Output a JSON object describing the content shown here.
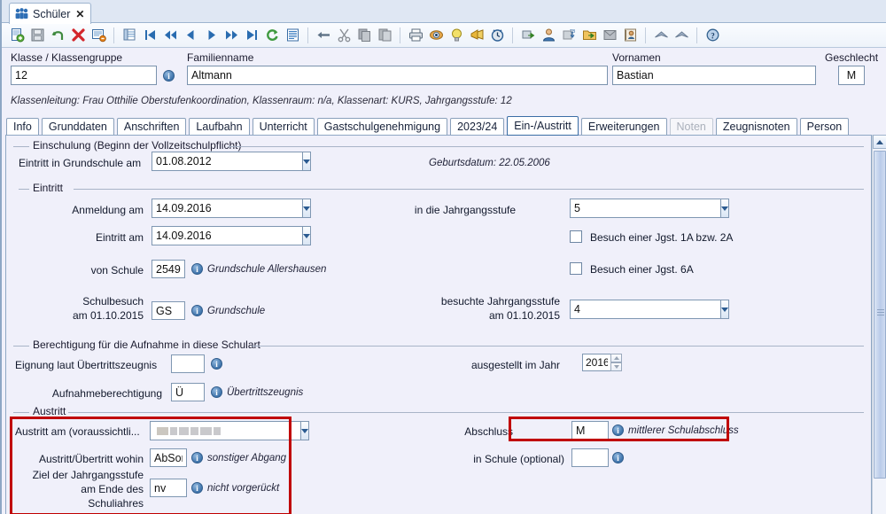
{
  "window": {
    "tab_label": "Schüler",
    "tab_close": "✕",
    "tab_icon": "people-icon"
  },
  "toolbar": {
    "buttons": [
      {
        "name": "new-record-icon",
        "title": "Neu"
      },
      {
        "name": "save-icon",
        "title": "Speichern"
      },
      {
        "name": "undo-icon",
        "title": "Rückgängig"
      },
      {
        "name": "delete-icon",
        "title": "Löschen"
      },
      {
        "name": "list-edit-icon",
        "title": "Bearbeiten"
      },
      {
        "name": "table-view-icon",
        "title": "Tabellenansicht"
      },
      {
        "name": "first-record-icon",
        "title": "Erster Datensatz"
      },
      {
        "name": "fast-back-icon",
        "title": "Zurück"
      },
      {
        "name": "prev-record-icon",
        "title": "Vorheriger"
      },
      {
        "name": "next-record-icon",
        "title": "Nächster"
      },
      {
        "name": "fast-forward-icon",
        "title": "Vorwärts"
      },
      {
        "name": "last-record-icon",
        "title": "Letzter Datensatz"
      },
      {
        "name": "refresh-icon",
        "title": "Aktualisieren"
      },
      {
        "name": "report-icon",
        "title": "Bericht"
      },
      {
        "name": "back-arrow-icon",
        "title": "Zurück"
      },
      {
        "name": "cut-icon",
        "title": "Ausschneiden"
      },
      {
        "name": "copy-icon",
        "title": "Kopieren"
      },
      {
        "name": "paste-icon",
        "title": "Einfügen"
      },
      {
        "name": "print-icon",
        "title": "Drucken"
      },
      {
        "name": "preview-icon",
        "title": "Vorschau"
      },
      {
        "name": "hint-icon",
        "title": "Hinweis"
      },
      {
        "name": "announce-icon",
        "title": "Meldung"
      },
      {
        "name": "clock-icon",
        "title": "Termin"
      },
      {
        "name": "package-export-icon",
        "title": "Export"
      },
      {
        "name": "user-icon",
        "title": "Benutzer"
      },
      {
        "name": "import-tb-icon",
        "title": "Import"
      },
      {
        "name": "folder-export-icon",
        "title": "Ordner Export"
      },
      {
        "name": "document-icon",
        "title": "Dokument"
      },
      {
        "name": "contact-card-icon",
        "title": "Kontakt"
      },
      {
        "name": "up-chevron-icon",
        "title": "Nach oben"
      },
      {
        "name": "up-chevron-2-icon",
        "title": "Ganz nach oben"
      },
      {
        "name": "help-icon",
        "title": "Hilfe"
      }
    ]
  },
  "header": {
    "klasse_label": "Klasse / Klassengruppe",
    "klasse_value": "12",
    "familienname_label": "Familienname",
    "familienname_value": "Altmann",
    "vornamen_label": "Vornamen",
    "vornamen_value": "Bastian",
    "geschlecht_label": "Geschlecht",
    "geschlecht_value": "M",
    "subline": "Klassenleitung: Frau Otthilie Oberstufenkoordination, Klassenraum: n/a, Klassenart: KURS, Jahrgangsstufe: 12"
  },
  "tabs": [
    {
      "label": "Info",
      "active": false,
      "disabled": false
    },
    {
      "label": "Grunddaten",
      "active": false,
      "disabled": false
    },
    {
      "label": "Anschriften",
      "active": false,
      "disabled": false
    },
    {
      "label": "Laufbahn",
      "active": false,
      "disabled": false
    },
    {
      "label": "Unterricht",
      "active": false,
      "disabled": false
    },
    {
      "label": "Gastschulgenehmigung",
      "active": false,
      "disabled": false
    },
    {
      "label": "2023/24",
      "active": false,
      "disabled": false
    },
    {
      "label": "Ein-/Austritt",
      "active": true,
      "disabled": false
    },
    {
      "label": "Erweiterungen",
      "active": false,
      "disabled": false
    },
    {
      "label": "Noten",
      "active": false,
      "disabled": true
    },
    {
      "label": "Zeugnisnoten",
      "active": false,
      "disabled": false
    },
    {
      "label": "Person",
      "active": false,
      "disabled": false
    }
  ],
  "einschulung": {
    "group_title": "Einschulung (Beginn der Vollzeitschulpflicht)",
    "eintritt_gs_label": "Eintritt in Grundschule am",
    "eintritt_gs_value": "01.08.2012",
    "geburtsdatum_note": "Geburtsdatum: 22.05.2006"
  },
  "eintritt": {
    "group_title": "Eintritt",
    "anmeldung_label": "Anmeldung am",
    "anmeldung_value": "14.09.2016",
    "eintritt_label": "Eintritt am",
    "eintritt_value": "14.09.2016",
    "von_schule_label": "von Schule",
    "von_schule_value": "2549",
    "von_schule_note": "Grundschule Allershausen",
    "schulbesuch_label_1": "Schulbesuch",
    "schulbesuch_label_2": "am 01.10.2015",
    "schulbesuch_value": "GS",
    "schulbesuch_note": "Grundschule",
    "jahrgangsstufe_label": "in die Jahrgangsstufe",
    "jahrgangsstufe_value": "5",
    "check_1a2a_label": "Besuch einer Jgst. 1A bzw. 2A",
    "check_1a2a_checked": false,
    "check_6a_label": "Besuch einer Jgst. 6A",
    "check_6a_checked": false,
    "besuchte_label_1": "besuchte Jahrgangsstufe",
    "besuchte_label_2": "am 01.10.2015",
    "besuchte_value": "4"
  },
  "berechtigung": {
    "group_title": "Berechtigung für die Aufnahme in diese Schulart",
    "eignung_label": "Eignung laut Übertrittszeugnis",
    "eignung_value": "",
    "aufnahme_label": "Aufnahmeberechtigung",
    "aufnahme_value": "Ü",
    "aufnahme_note": "Übertrittszeugnis",
    "ausgestellt_label": "ausgestellt im Jahr",
    "ausgestellt_value": "2016"
  },
  "austritt": {
    "group_title": "Austritt",
    "austritt_am_label": "Austritt am (voraussichtli...",
    "austritt_am_value": "",
    "austritt_am_redacted": true,
    "wohin_label": "Austritt/Übertritt wohin",
    "wohin_value": "AbSon",
    "wohin_note": "sonstiger Abgang",
    "ziel_label_1": "Ziel der Jahrgangsstufe",
    "ziel_label_2": "am Ende des",
    "ziel_label_3": "Schuliahres",
    "ziel_value": "nv",
    "ziel_note": "nicht vorgerückt",
    "abschluss_label": "Abschluss",
    "abschluss_value": "M",
    "abschluss_note": "mittlerer Schulabschluss",
    "in_schule_label": "in Schule (optional)",
    "in_schule_value": ""
  },
  "highlights": {
    "color": "#c00000",
    "boxes": [
      "austritt-left-group",
      "abschluss-field-group"
    ]
  },
  "scrollbar": {
    "up_arrow": "scroll-up-arrow",
    "thumb": "scroll-thumb"
  }
}
